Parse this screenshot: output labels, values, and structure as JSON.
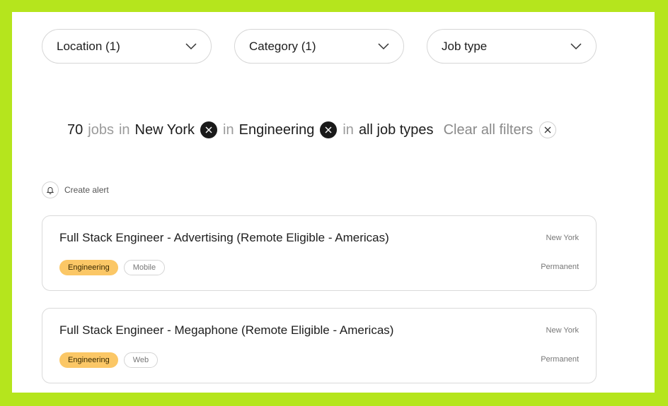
{
  "filters": [
    {
      "label": "Location (1)"
    },
    {
      "label": "Category (1)"
    },
    {
      "label": "Job type"
    }
  ],
  "summary": {
    "count": "70",
    "jobs_word": "jobs",
    "in1": "in",
    "location": "New York",
    "in2": "in",
    "category": "Engineering",
    "in3": "in",
    "job_types": "all job types",
    "clear_label": "Clear all filters"
  },
  "alert": {
    "label": "Create alert"
  },
  "jobs": [
    {
      "title": "Full Stack Engineer - Advertising (Remote Eligible - Americas)",
      "location": "New York",
      "type": "Permanent",
      "tags": [
        "Engineering",
        "Mobile"
      ]
    },
    {
      "title": "Full Stack Engineer - Megaphone (Remote Eligible - Americas)",
      "location": "New York",
      "type": "Permanent",
      "tags": [
        "Engineering",
        "Web"
      ]
    }
  ],
  "colors": {
    "page_border": "#b5e51d",
    "tag_primary": "#fbc766"
  }
}
